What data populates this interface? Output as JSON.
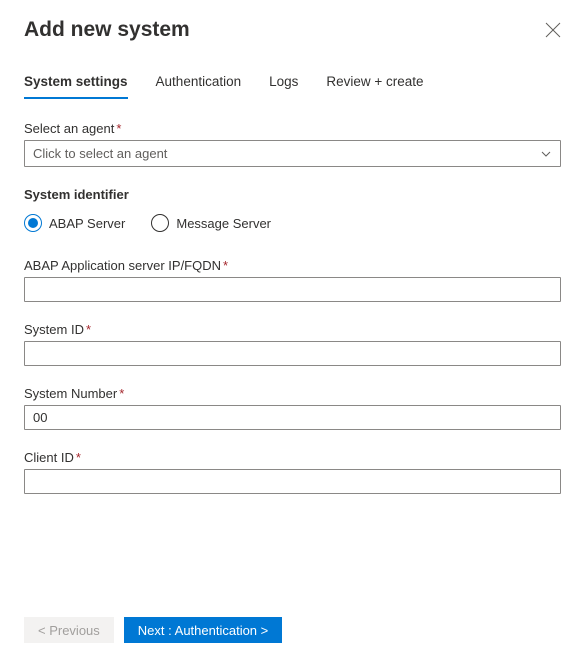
{
  "header": {
    "title": "Add new system"
  },
  "tabs": [
    {
      "label": "System settings",
      "active": true
    },
    {
      "label": "Authentication",
      "active": false
    },
    {
      "label": "Logs",
      "active": false
    },
    {
      "label": "Review + create",
      "active": false
    }
  ],
  "fields": {
    "agent": {
      "label": "Select an agent",
      "placeholder": "Click to select an agent"
    },
    "systemIdentifier": {
      "header": "System identifier",
      "options": [
        {
          "label": "ABAP Server",
          "checked": true
        },
        {
          "label": "Message Server",
          "checked": false
        }
      ]
    },
    "abapServer": {
      "label": "ABAP Application server IP/FQDN",
      "value": ""
    },
    "systemId": {
      "label": "System ID",
      "value": ""
    },
    "systemNumber": {
      "label": "System Number",
      "value": "00"
    },
    "clientId": {
      "label": "Client ID",
      "value": ""
    }
  },
  "footer": {
    "previous": "< Previous",
    "next": "Next : Authentication  >"
  }
}
